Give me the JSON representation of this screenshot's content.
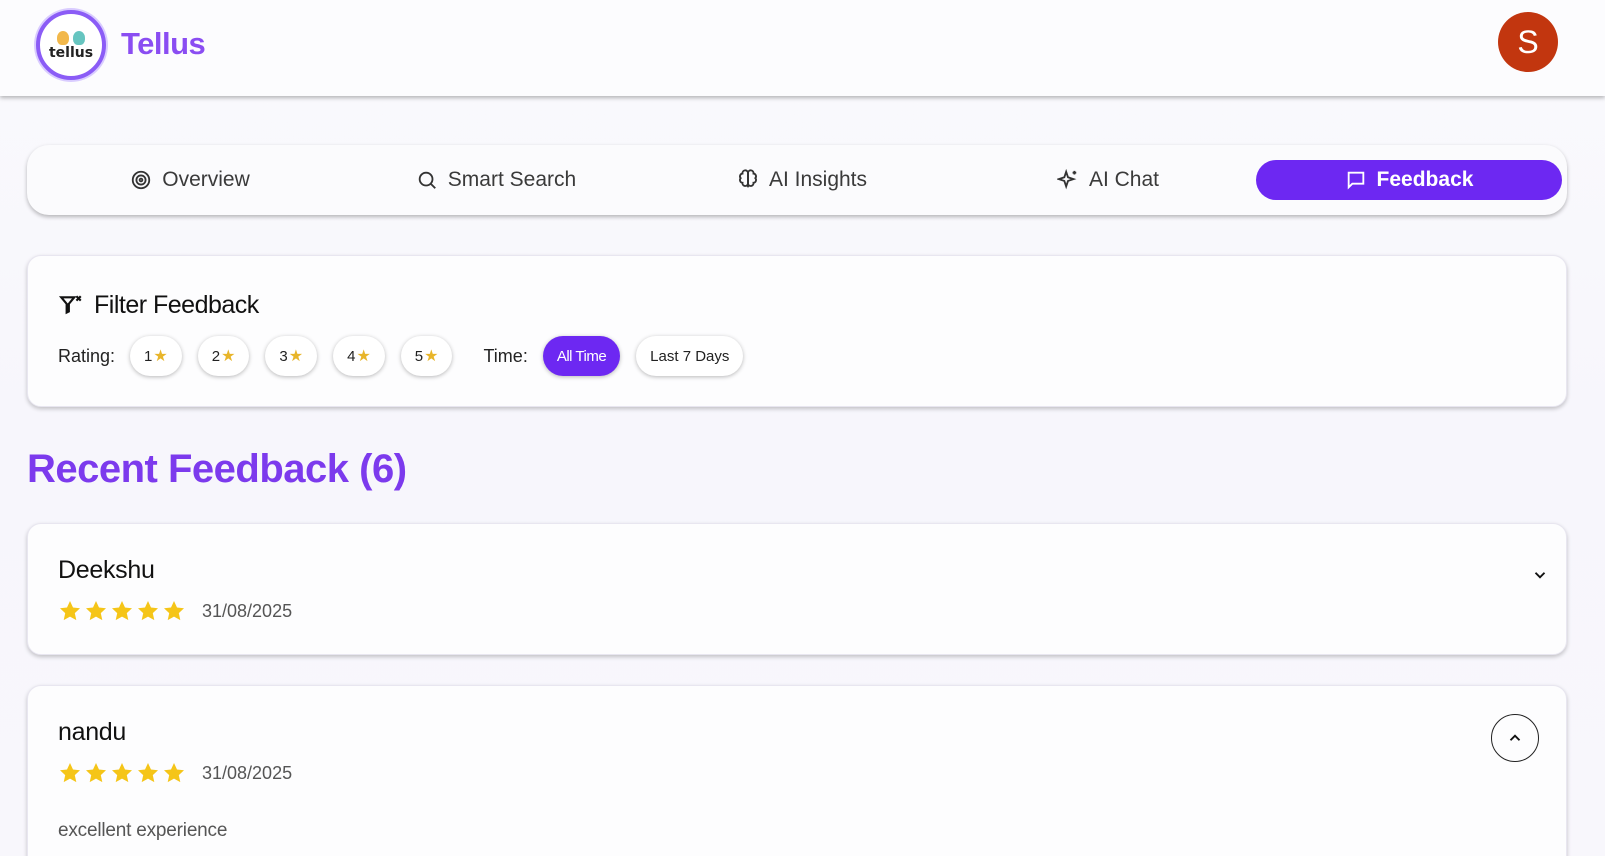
{
  "header": {
    "logo_text": "tellus",
    "brand": "Tellus",
    "avatar_initial": "S",
    "avatar_color": "#c2360f"
  },
  "tabs": [
    {
      "label": "Overview",
      "icon": "target-icon",
      "active": false
    },
    {
      "label": "Smart Search",
      "icon": "search-icon",
      "active": false
    },
    {
      "label": "AI Insights",
      "icon": "brain-icon",
      "active": false
    },
    {
      "label": "AI Chat",
      "icon": "sparkles-icon",
      "active": false
    },
    {
      "label": "Feedback",
      "icon": "message-square-icon",
      "active": true
    }
  ],
  "accent_color": "#6d28f2",
  "filter": {
    "title": "Filter Feedback",
    "rating_label": "Rating:",
    "ratings": [
      "1",
      "2",
      "3",
      "4",
      "5"
    ],
    "time_label": "Time:",
    "time_options": [
      {
        "label": "All Time",
        "active": true
      },
      {
        "label": "Last 7 Days",
        "active": false
      }
    ]
  },
  "feedback_section": {
    "heading": "Recent Feedback (6)",
    "items": [
      {
        "name": "Deekshu",
        "rating": 5,
        "date": "31/08/2025",
        "expanded": false,
        "comment": ""
      },
      {
        "name": "nandu",
        "rating": 5,
        "date": "31/08/2025",
        "expanded": true,
        "comment": "excellent experience"
      }
    ]
  }
}
